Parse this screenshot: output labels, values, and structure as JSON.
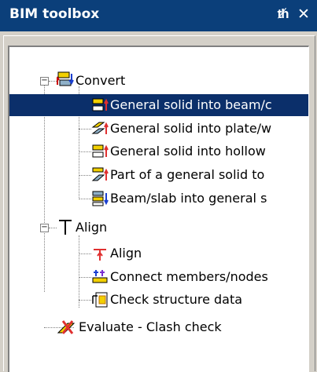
{
  "window": {
    "title": "BIM toolbox",
    "pin_icon": "pin-icon",
    "close_icon": "close-icon"
  },
  "tree": {
    "convert": {
      "label": "Convert",
      "expanded": true,
      "icon": "convert-icon",
      "children": [
        {
          "label": "General solid into beam/c",
          "icon": "solid-to-beam-icon",
          "selected": true
        },
        {
          "label": "General solid into plate/w",
          "icon": "solid-to-plate-icon"
        },
        {
          "label": "General solid into hollow",
          "icon": "solid-to-hollow-icon"
        },
        {
          "label": "Part of a general solid to",
          "icon": "part-solid-icon"
        },
        {
          "label": "Beam/slab into general s",
          "icon": "beam-to-solid-icon"
        }
      ]
    },
    "align": {
      "label": "Align",
      "expanded": true,
      "icon": "align-icon",
      "children": [
        {
          "label": "Align",
          "icon": "align-arrows-icon"
        },
        {
          "label": "Connect members/nodes",
          "icon": "connect-members-icon"
        },
        {
          "label": "Check structure data",
          "icon": "check-structure-icon"
        }
      ]
    },
    "evaluate": {
      "label": "Evaluate - Clash check",
      "icon": "clash-check-icon"
    }
  },
  "colors": {
    "titlebar": "#0b3f7a",
    "selection": "#0b2f6a",
    "panel": "#d4d0c8"
  }
}
